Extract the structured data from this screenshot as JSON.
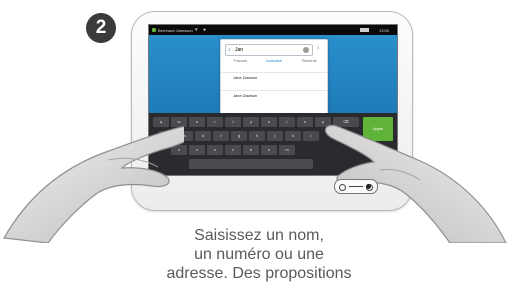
{
  "step_number": "2",
  "status_bar": {
    "user": "Bernhard Johnsson",
    "time": "13:50"
  },
  "search": {
    "value": "Jan"
  },
  "tabs": [
    "Favoris",
    "Annuaire",
    "Récents"
  ],
  "active_tab": "Annuaire",
  "results": [
    {
      "name": "Jane Dawson"
    },
    {
      "name": "Jane Dawson"
    }
  ],
  "keyboard": {
    "row1": [
      "q",
      "w",
      "e",
      "r",
      "t",
      "y",
      "u",
      "i",
      "o",
      "p"
    ],
    "row2": [
      "a",
      "s",
      "d",
      "f",
      "g",
      "h",
      "j",
      "k",
      "l"
    ],
    "row3": [
      "z",
      "x",
      "c",
      "v",
      "b",
      "n",
      "m"
    ],
    "action_key": "Appel"
  },
  "caption_lines": [
    "Saisissez un nom,",
    "un numéro ou une",
    "adresse. Des propositions"
  ],
  "colors": {
    "screen_bg": "#1c7db9",
    "accent_green": "#5fb336",
    "tab_active": "#1f8ad2"
  }
}
